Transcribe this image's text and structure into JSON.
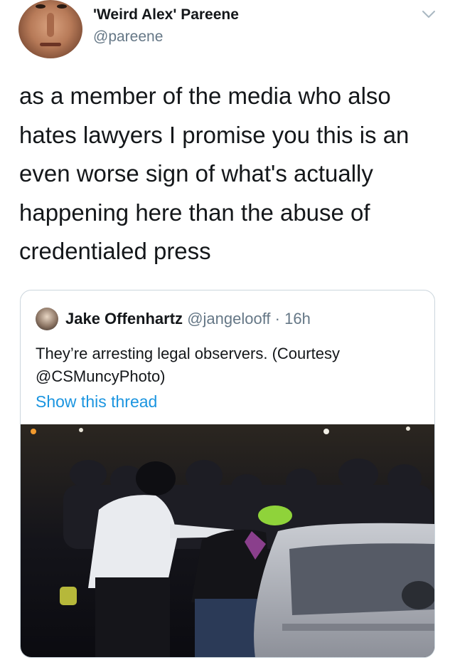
{
  "author": {
    "display_name": "'Weird Alex' Pareene",
    "handle": "@pareene"
  },
  "tweet": {
    "text": "as a member of the media who also hates lawyers I promise you this is an even worse sign of what's actually happening here than the abuse of credentialed press"
  },
  "quoted_tweet": {
    "display_name": "Jake Offenhartz",
    "handle": "@jangelooff",
    "separator": "·",
    "time": "16h",
    "text": "They’re arresting legal observers. (Courtesy @CSMuncyPhoto)",
    "show_thread_label": "Show this thread"
  },
  "icons": {
    "more": "chevron-down-icon"
  },
  "colors": {
    "link": "#1b95e0",
    "secondary_text": "#657786",
    "border": "#ccd6dd"
  }
}
